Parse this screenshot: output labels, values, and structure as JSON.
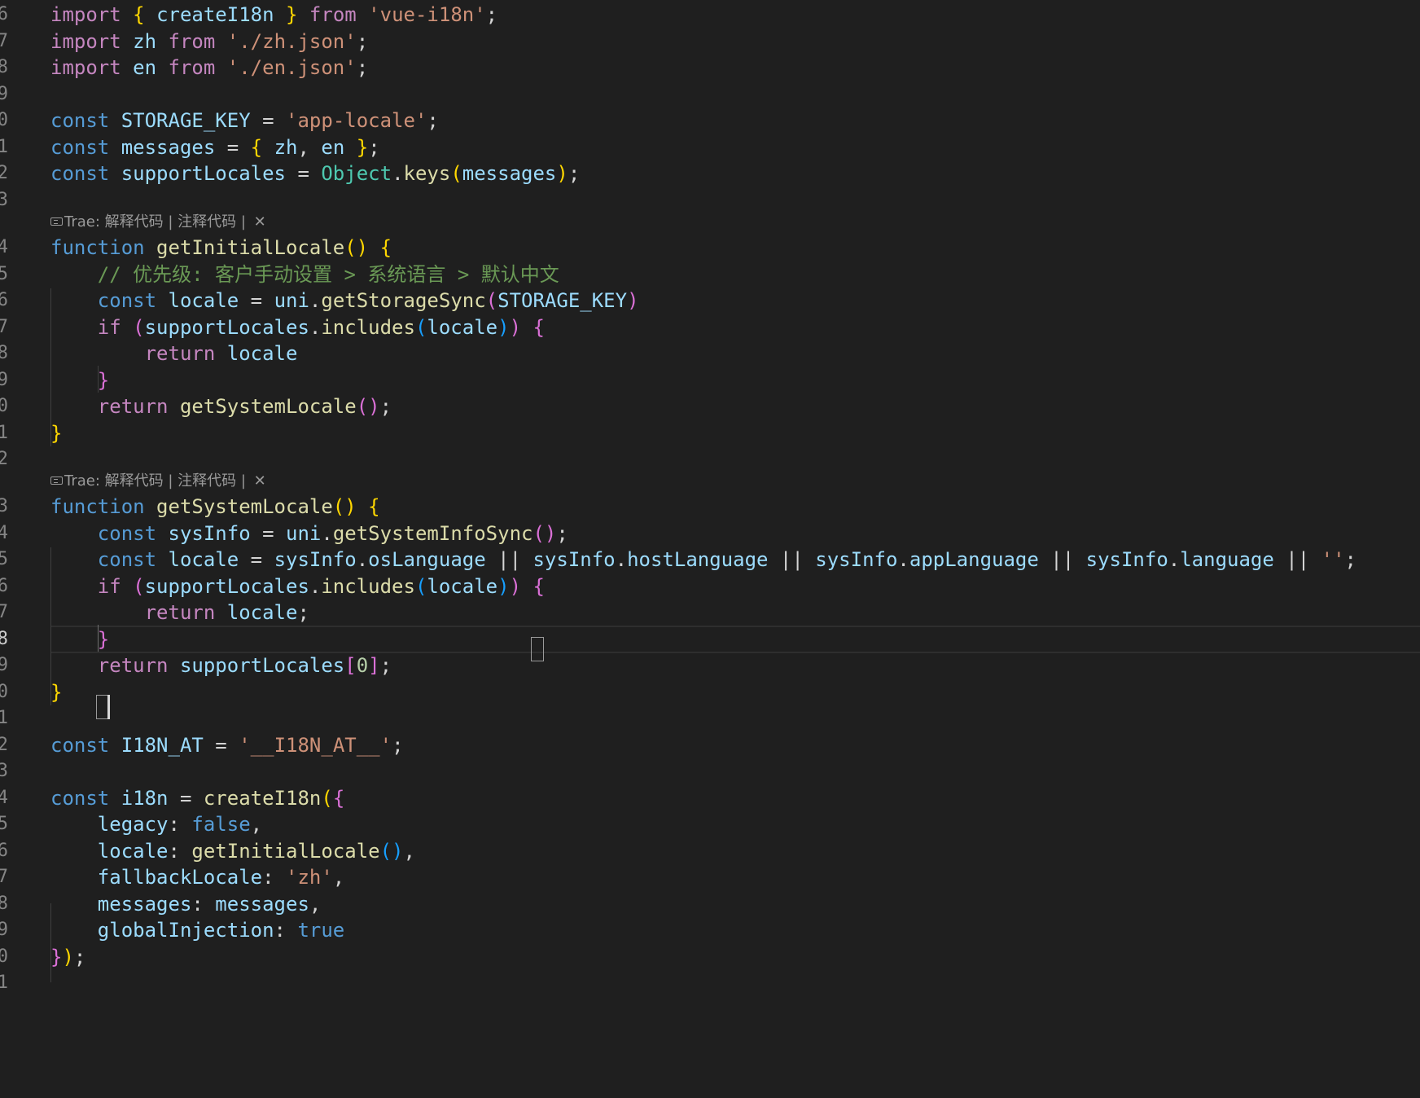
{
  "editor": {
    "theme_colors": {
      "keyword": "#569cd6",
      "control": "#c586c0",
      "string": "#ce9178",
      "variable": "#9cdcfe",
      "function": "#dcdcaa",
      "type": "#4ec9b0",
      "comment": "#6a9955",
      "number": "#b5cea8",
      "bracket_gold": "#ffd700",
      "bracket_pink": "#da70d6",
      "bracket_blue": "#179fff",
      "plain": "#d4d4d4"
    },
    "codelens": {
      "label": "Trae: 解释代码 | 注释代码 | ",
      "close_icon": "✕"
    },
    "lines": [
      {
        "num": "6",
        "tokens": [
          [
            "import",
            "control"
          ],
          [
            " ",
            "plain"
          ],
          [
            "{",
            "bracket_gold"
          ],
          [
            " ",
            "plain"
          ],
          [
            "createI18n",
            "variable"
          ],
          [
            " ",
            "plain"
          ],
          [
            "}",
            "bracket_gold"
          ],
          [
            " ",
            "plain"
          ],
          [
            "from",
            "control"
          ],
          [
            " ",
            "plain"
          ],
          [
            "'vue-i18n'",
            "string"
          ],
          [
            ";",
            "plain"
          ]
        ]
      },
      {
        "num": "7",
        "tokens": [
          [
            "import",
            "control"
          ],
          [
            " ",
            "plain"
          ],
          [
            "zh",
            "variable"
          ],
          [
            " ",
            "plain"
          ],
          [
            "from",
            "control"
          ],
          [
            " ",
            "plain"
          ],
          [
            "'./zh.json'",
            "string"
          ],
          [
            ";",
            "plain"
          ]
        ]
      },
      {
        "num": "8",
        "tokens": [
          [
            "import",
            "control"
          ],
          [
            " ",
            "plain"
          ],
          [
            "en",
            "variable"
          ],
          [
            " ",
            "plain"
          ],
          [
            "from",
            "control"
          ],
          [
            " ",
            "plain"
          ],
          [
            "'./en.json'",
            "string"
          ],
          [
            ";",
            "plain"
          ]
        ]
      },
      {
        "num": "9",
        "tokens": []
      },
      {
        "num": "0",
        "tokens": [
          [
            "const",
            "keyword"
          ],
          [
            " ",
            "plain"
          ],
          [
            "STORAGE_KEY",
            "variable"
          ],
          [
            " = ",
            "plain"
          ],
          [
            "'app-locale'",
            "string"
          ],
          [
            ";",
            "plain"
          ]
        ]
      },
      {
        "num": "1",
        "tokens": [
          [
            "const",
            "keyword"
          ],
          [
            " ",
            "plain"
          ],
          [
            "messages",
            "variable"
          ],
          [
            " = ",
            "plain"
          ],
          [
            "{",
            "bracket_gold"
          ],
          [
            " ",
            "plain"
          ],
          [
            "zh",
            "variable"
          ],
          [
            ", ",
            "plain"
          ],
          [
            "en",
            "variable"
          ],
          [
            " ",
            "plain"
          ],
          [
            "}",
            "bracket_gold"
          ],
          [
            ";",
            "plain"
          ]
        ]
      },
      {
        "num": "2",
        "tokens": [
          [
            "const",
            "keyword"
          ],
          [
            " ",
            "plain"
          ],
          [
            "supportLocales",
            "variable"
          ],
          [
            " = ",
            "plain"
          ],
          [
            "Object",
            "type"
          ],
          [
            ".",
            "plain"
          ],
          [
            "keys",
            "function"
          ],
          [
            "(",
            "bracket_gold"
          ],
          [
            "messages",
            "variable"
          ],
          [
            ")",
            "bracket_gold"
          ],
          [
            ";",
            "plain"
          ]
        ]
      },
      {
        "num": "3",
        "tokens": []
      },
      {
        "num": "",
        "lens": true
      },
      {
        "num": "4",
        "tokens": [
          [
            "function",
            "keyword"
          ],
          [
            " ",
            "plain"
          ],
          [
            "getInitialLocale",
            "function"
          ],
          [
            "()",
            "bracket_gold"
          ],
          [
            " ",
            "plain"
          ],
          [
            "{",
            "bracket_gold"
          ]
        ]
      },
      {
        "num": "5",
        "tokens": [
          [
            "    ",
            "plain"
          ],
          [
            "// 优先级: 客户手动设置 > 系统语言 > 默认中文",
            "comment"
          ]
        ]
      },
      {
        "num": "6",
        "tokens": [
          [
            "    ",
            "plain"
          ],
          [
            "const",
            "keyword"
          ],
          [
            " ",
            "plain"
          ],
          [
            "locale",
            "variable"
          ],
          [
            " = ",
            "plain"
          ],
          [
            "uni",
            "variable"
          ],
          [
            ".",
            "plain"
          ],
          [
            "getStorageSync",
            "function"
          ],
          [
            "(",
            "bracket_pink"
          ],
          [
            "STORAGE_KEY",
            "variable"
          ],
          [
            ")",
            "bracket_pink"
          ]
        ]
      },
      {
        "num": "7",
        "tokens": [
          [
            "    ",
            "plain"
          ],
          [
            "if",
            "control"
          ],
          [
            " ",
            "plain"
          ],
          [
            "(",
            "bracket_pink"
          ],
          [
            "supportLocales",
            "variable"
          ],
          [
            ".",
            "plain"
          ],
          [
            "includes",
            "function"
          ],
          [
            "(",
            "bracket_blue"
          ],
          [
            "locale",
            "variable"
          ],
          [
            ")",
            "bracket_blue"
          ],
          [
            ")",
            "bracket_pink"
          ],
          [
            " ",
            "plain"
          ],
          [
            "{",
            "bracket_pink"
          ]
        ]
      },
      {
        "num": "8",
        "tokens": [
          [
            "        ",
            "plain"
          ],
          [
            "return",
            "control"
          ],
          [
            " ",
            "plain"
          ],
          [
            "locale",
            "variable"
          ]
        ]
      },
      {
        "num": "9",
        "tokens": [
          [
            "    ",
            "plain"
          ],
          [
            "}",
            "bracket_pink"
          ]
        ]
      },
      {
        "num": "0",
        "tokens": [
          [
            "    ",
            "plain"
          ],
          [
            "return",
            "control"
          ],
          [
            " ",
            "plain"
          ],
          [
            "getSystemLocale",
            "function"
          ],
          [
            "()",
            "bracket_pink"
          ],
          [
            ";",
            "plain"
          ]
        ]
      },
      {
        "num": "1",
        "tokens": [
          [
            "}",
            "bracket_gold"
          ]
        ]
      },
      {
        "num": "2",
        "tokens": []
      },
      {
        "num": "",
        "lens": true
      },
      {
        "num": "3",
        "tokens": [
          [
            "function",
            "keyword"
          ],
          [
            " ",
            "plain"
          ],
          [
            "getSystemLocale",
            "function"
          ],
          [
            "()",
            "bracket_gold"
          ],
          [
            " ",
            "plain"
          ],
          [
            "{",
            "bracket_gold"
          ]
        ]
      },
      {
        "num": "4",
        "tokens": [
          [
            "    ",
            "plain"
          ],
          [
            "const",
            "keyword"
          ],
          [
            " ",
            "plain"
          ],
          [
            "sysInfo",
            "variable"
          ],
          [
            " = ",
            "plain"
          ],
          [
            "uni",
            "variable"
          ],
          [
            ".",
            "plain"
          ],
          [
            "getSystemInfoSync",
            "function"
          ],
          [
            "()",
            "bracket_pink"
          ],
          [
            ";",
            "plain"
          ]
        ]
      },
      {
        "num": "5",
        "tokens": [
          [
            "    ",
            "plain"
          ],
          [
            "const",
            "keyword"
          ],
          [
            " ",
            "plain"
          ],
          [
            "locale",
            "variable"
          ],
          [
            " = ",
            "plain"
          ],
          [
            "sysInfo",
            "variable"
          ],
          [
            ".",
            "plain"
          ],
          [
            "osLanguage",
            "variable"
          ],
          [
            " || ",
            "plain"
          ],
          [
            "sysInfo",
            "variable"
          ],
          [
            ".",
            "plain"
          ],
          [
            "hostLanguage",
            "variable"
          ],
          [
            " || ",
            "plain"
          ],
          [
            "sysInfo",
            "variable"
          ],
          [
            ".",
            "plain"
          ],
          [
            "appLanguage",
            "variable"
          ],
          [
            " || ",
            "plain"
          ],
          [
            "sysInfo",
            "variable"
          ],
          [
            ".",
            "plain"
          ],
          [
            "language",
            "variable"
          ],
          [
            " || ",
            "plain"
          ],
          [
            "''",
            "string"
          ],
          [
            ";",
            "plain"
          ]
        ]
      },
      {
        "num": "6",
        "tokens": [
          [
            "    ",
            "plain"
          ],
          [
            "if",
            "control"
          ],
          [
            " ",
            "plain"
          ],
          [
            "(",
            "bracket_pink"
          ],
          [
            "supportLocales",
            "variable"
          ],
          [
            ".",
            "plain"
          ],
          [
            "includes",
            "function"
          ],
          [
            "(",
            "bracket_blue"
          ],
          [
            "locale",
            "variable"
          ],
          [
            ")",
            "bracket_blue"
          ],
          [
            ")",
            "bracket_pink"
          ],
          [
            " ",
            "plain"
          ],
          [
            "{",
            "bracket_pink"
          ]
        ]
      },
      {
        "num": "7",
        "tokens": [
          [
            "        ",
            "plain"
          ],
          [
            "return",
            "control"
          ],
          [
            " ",
            "plain"
          ],
          [
            "locale",
            "variable"
          ],
          [
            ";",
            "plain"
          ]
        ]
      },
      {
        "num": "8",
        "current": true,
        "tokens": [
          [
            "    ",
            "plain"
          ],
          [
            "}",
            "bracket_pink"
          ]
        ]
      },
      {
        "num": "9",
        "tokens": [
          [
            "    ",
            "plain"
          ],
          [
            "return",
            "control"
          ],
          [
            " ",
            "plain"
          ],
          [
            "supportLocales",
            "variable"
          ],
          [
            "[",
            "bracket_pink"
          ],
          [
            "0",
            "number"
          ],
          [
            "]",
            "bracket_pink"
          ],
          [
            ";",
            "plain"
          ]
        ]
      },
      {
        "num": "0",
        "tokens": [
          [
            "}",
            "bracket_gold"
          ]
        ]
      },
      {
        "num": "1",
        "tokens": []
      },
      {
        "num": "2",
        "tokens": [
          [
            "const",
            "keyword"
          ],
          [
            " ",
            "plain"
          ],
          [
            "I18N_AT",
            "variable"
          ],
          [
            " = ",
            "plain"
          ],
          [
            "'__I18N_AT__'",
            "string"
          ],
          [
            ";",
            "plain"
          ]
        ]
      },
      {
        "num": "3",
        "tokens": []
      },
      {
        "num": "4",
        "tokens": [
          [
            "const",
            "keyword"
          ],
          [
            " ",
            "plain"
          ],
          [
            "i18n",
            "variable"
          ],
          [
            " = ",
            "plain"
          ],
          [
            "createI18n",
            "function"
          ],
          [
            "(",
            "bracket_gold"
          ],
          [
            "{",
            "bracket_pink"
          ]
        ]
      },
      {
        "num": "5",
        "tokens": [
          [
            "    ",
            "plain"
          ],
          [
            "legacy",
            "variable"
          ],
          [
            ": ",
            "plain"
          ],
          [
            "false",
            "keyword"
          ],
          [
            ",",
            "plain"
          ]
        ]
      },
      {
        "num": "6",
        "tokens": [
          [
            "    ",
            "plain"
          ],
          [
            "locale",
            "variable"
          ],
          [
            ": ",
            "plain"
          ],
          [
            "getInitialLocale",
            "function"
          ],
          [
            "()",
            "bracket_blue"
          ],
          [
            ",",
            "plain"
          ]
        ]
      },
      {
        "num": "7",
        "tokens": [
          [
            "    ",
            "plain"
          ],
          [
            "fallbackLocale",
            "variable"
          ],
          [
            ": ",
            "plain"
          ],
          [
            "'zh'",
            "string"
          ],
          [
            ",",
            "plain"
          ]
        ]
      },
      {
        "num": "8",
        "tokens": [
          [
            "    ",
            "plain"
          ],
          [
            "messages",
            "variable"
          ],
          [
            ": ",
            "plain"
          ],
          [
            "messages",
            "variable"
          ],
          [
            ",",
            "plain"
          ]
        ]
      },
      {
        "num": "9",
        "tokens": [
          [
            "    ",
            "plain"
          ],
          [
            "globalInjection",
            "variable"
          ],
          [
            ": ",
            "plain"
          ],
          [
            "true",
            "keyword"
          ]
        ]
      },
      {
        "num": "0",
        "tokens": [
          [
            "}",
            "bracket_pink"
          ],
          [
            ")",
            "bracket_gold"
          ],
          [
            ";",
            "plain"
          ]
        ]
      },
      {
        "num": "1",
        "tokens": []
      }
    ]
  }
}
